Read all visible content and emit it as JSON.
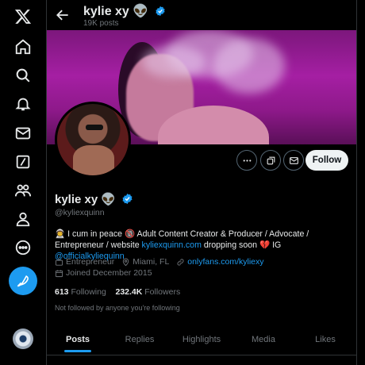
{
  "sidebar": {
    "items": [
      {
        "icon": "x-logo-icon"
      },
      {
        "icon": "home-icon"
      },
      {
        "icon": "search-icon"
      },
      {
        "icon": "bell-icon"
      },
      {
        "icon": "mail-icon"
      },
      {
        "icon": "grok-icon"
      },
      {
        "icon": "communities-icon"
      },
      {
        "icon": "profile-icon"
      },
      {
        "icon": "more-icon"
      }
    ],
    "compose_icon": "compose-icon"
  },
  "header": {
    "name": "kylie xy 👽",
    "post_count": "19K posts"
  },
  "profile": {
    "name": "kylie xy 👽",
    "handle": "@kyliexquinn",
    "bio_prefix": "👨‍🚀 I cum in peace 🔞 Adult Content Creator & Producer / Advocate / Entrepreneur / website ",
    "bio_link": "kyliexquinn.com",
    "bio_middle": " dropping soon 💔 IG ",
    "bio_mention": "@officialkyliequinn",
    "category": "Entrepreneur",
    "location": "Miami, FL",
    "website": "onlyfans.com/kyliexy",
    "joined": "Joined December 2015",
    "following_count": "613",
    "following_label": "Following",
    "followers_count": "232.4K",
    "followers_label": "Followers",
    "not_followed": "Not followed by anyone you're following",
    "follow_label": "Follow"
  },
  "tabs": [
    {
      "label": "Posts",
      "active": true
    },
    {
      "label": "Replies",
      "active": false
    },
    {
      "label": "Highlights",
      "active": false
    },
    {
      "label": "Media",
      "active": false
    },
    {
      "label": "Likes",
      "active": false
    }
  ],
  "colors": {
    "accent": "#1d9bf0",
    "background": "#000000",
    "muted": "#71767b",
    "text": "#e7e9ea"
  }
}
